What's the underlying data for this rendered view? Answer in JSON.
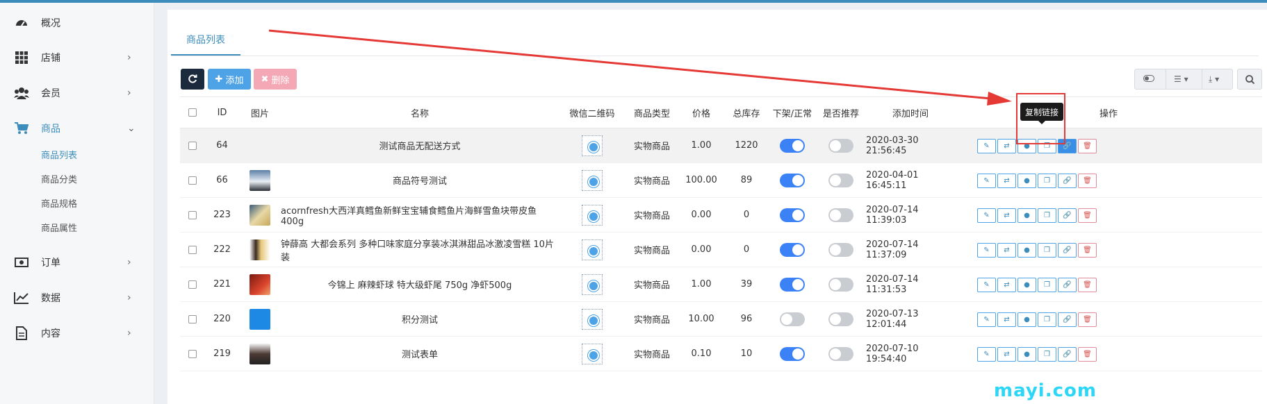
{
  "sidebar": {
    "items": [
      {
        "label": "概况",
        "icon": "dashboard-icon",
        "chevron": ""
      },
      {
        "label": "店铺",
        "icon": "grid-icon",
        "chevron": "›"
      },
      {
        "label": "会员",
        "icon": "users-icon",
        "chevron": "›"
      },
      {
        "label": "商品",
        "icon": "cart-icon",
        "chevron": "⌄"
      },
      {
        "label": "订单",
        "icon": "money-icon",
        "chevron": "›"
      },
      {
        "label": "数据",
        "icon": "chart-line-icon",
        "chevron": "›"
      },
      {
        "label": "内容",
        "icon": "file-icon",
        "chevron": "›"
      }
    ],
    "sub_items": [
      "商品列表",
      "商品分类",
      "商品规格",
      "商品属性"
    ]
  },
  "tab": {
    "label": "商品列表"
  },
  "toolbar": {
    "add_label": "添加",
    "delete_label": "删除"
  },
  "table": {
    "headers": {
      "id": "ID",
      "image": "图片",
      "name": "名称",
      "qrcode": "微信二维码",
      "type": "商品类型",
      "price": "价格",
      "stock": "总库存",
      "status": "下架/正常",
      "recommend": "是否推荐",
      "created": "添加时间",
      "actions": "操作"
    },
    "rows": [
      {
        "id": "64",
        "name": "测试商品无配送方式",
        "type": "实物商品",
        "price": "1.00",
        "stock": "1220",
        "status": true,
        "recommend": false,
        "created": "2020-03-30 21:56:45",
        "thumb": "",
        "highlight": true
      },
      {
        "id": "66",
        "name": "商品符号测试",
        "type": "实物商品",
        "price": "100.00",
        "stock": "89",
        "status": true,
        "recommend": false,
        "created": "2020-04-01 16:45:11",
        "thumb": "penguins"
      },
      {
        "id": "223",
        "name": "acornfresh大西洋真鳕鱼新鲜宝宝辅食鳕鱼片海鲜雪鱼块带皮鱼400g",
        "type": "实物商品",
        "price": "0.00",
        "stock": "0",
        "status": true,
        "recommend": false,
        "created": "2020-07-14 11:39:03",
        "thumb": "fish"
      },
      {
        "id": "222",
        "name": "钟薛高 大都会系列 多种口味家庭分享装冰淇淋甜品冰激凌雪糕 10片装",
        "type": "实物商品",
        "price": "0.00",
        "stock": "0",
        "status": true,
        "recommend": false,
        "created": "2020-07-14 11:37:09",
        "thumb": "icecream"
      },
      {
        "id": "221",
        "name": "今锦上 麻辣虾球 特大级虾尾 750g 净虾500g",
        "type": "实物商品",
        "price": "1.00",
        "stock": "39",
        "status": true,
        "recommend": false,
        "created": "2020-07-14 11:31:53",
        "thumb": "shrimp"
      },
      {
        "id": "220",
        "name": "积分测试",
        "type": "实物商品",
        "price": "10.00",
        "stock": "96",
        "status": false,
        "recommend": false,
        "created": "2020-07-13 12:01:44",
        "thumb": "logo"
      },
      {
        "id": "219",
        "name": "测试表单",
        "type": "实物商品",
        "price": "0.10",
        "stock": "10",
        "status": true,
        "recommend": false,
        "created": "2020-07-10 19:54:40",
        "thumb": "person"
      }
    ]
  },
  "tooltip": {
    "label": "复制链接"
  },
  "watermark": {
    "text": "mayi.com"
  },
  "colors": {
    "accent": "#3c8dbc",
    "annotation": "#e53935"
  }
}
